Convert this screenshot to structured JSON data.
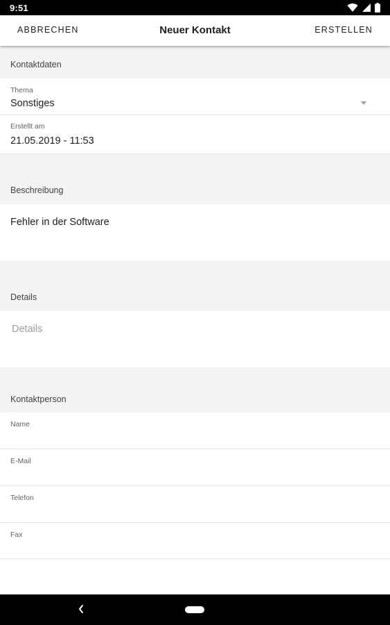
{
  "status_bar": {
    "time": "9:51",
    "icons": [
      "wifi-icon",
      "signal-icon",
      "battery-icon"
    ]
  },
  "app_bar": {
    "cancel_label": "ABBRECHEN",
    "title": "Neuer Kontakt",
    "create_label": "ERSTELLEN"
  },
  "contact_data": {
    "section_label": "Kontaktdaten",
    "topic": {
      "label": "Thema",
      "value": "Sonstiges"
    },
    "created": {
      "label": "Erstellt am",
      "value": "21.05.2019 - 11:53"
    }
  },
  "description": {
    "section_label": "Beschreibung",
    "value": "Fehler in der Software"
  },
  "details": {
    "section_label": "Details",
    "placeholder": "Details"
  },
  "contact_person": {
    "section_label": "Kontaktperson",
    "fields": [
      {
        "label": "Name",
        "value": ""
      },
      {
        "label": "E-Mail",
        "value": ""
      },
      {
        "label": "Telefon",
        "value": ""
      },
      {
        "label": "Fax",
        "value": ""
      }
    ]
  },
  "nav_bar": {
    "icons": [
      "back-icon",
      "home-pill-icon"
    ]
  },
  "colors": {
    "section_background": "#f3f3f3",
    "divider": "#e4e4e4",
    "placeholder_text": "#9e9e9e"
  }
}
